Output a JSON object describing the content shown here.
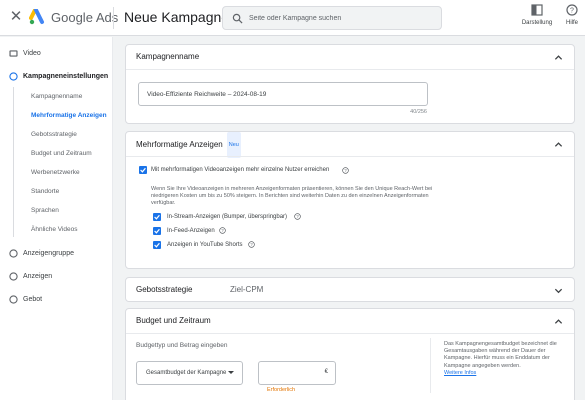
{
  "header": {
    "brand": "Google Ads",
    "title": "Neue Kampagne",
    "search_placeholder": "Seite oder Kampagne suchen",
    "buttons": [
      {
        "label": "Darstellung",
        "icon": "layout-icon"
      },
      {
        "label": "Hilfe",
        "icon": "help-icon"
      }
    ]
  },
  "sidebar": {
    "items": [
      {
        "label": "Video",
        "icon": "video-icon"
      },
      {
        "label": "Kampagneneinstellungen",
        "icon": "circle-outline-icon"
      },
      {
        "label": "Anzeigengruppe",
        "icon": "circle-outline-icon"
      },
      {
        "label": "Anzeigen",
        "icon": "circle-outline-icon"
      },
      {
        "label": "Gebot",
        "icon": "circle-outline-icon"
      }
    ],
    "sub_items": [
      "Kampagnenname",
      "Mehrformatige Anzeigen",
      "Gebotsstrategie",
      "Budget und Zeitraum",
      "Werbenetzwerke",
      "Standorte",
      "Sprachen",
      "Ähnliche Videos"
    ],
    "active_sub_item": "Mehrformatige Anzeigen"
  },
  "campaign_name": {
    "heading": "Kampagnenname",
    "value": "Video-Effiziente Reichweite – 2024-08-19",
    "counter": "40/256"
  },
  "multiformat": {
    "heading": "Mehrformatige Anzeigen",
    "badge": "Neu",
    "main_checkbox_label": "Mit mehrformatigen Videoanzeigen mehr einzelne Nutzer erreichen",
    "description": "Wenn Sie Ihre Videoanzeigen in mehreren Anzeigenformaten präsentieren, können Sie den Unique Reach-Wert bei niedrigeren Kosten um bis zu 50% steigern. In Berichten sind weiterhin Daten zu den einzelnen Anzeigenformaten verfügbar.",
    "options": [
      {
        "label": "In-Stream-Anzeigen (Bumper, überspringbar)",
        "checked": true
      },
      {
        "label": "In-Feed-Anzeigen",
        "checked": true
      },
      {
        "label": "Anzeigen in YouTube Shorts",
        "checked": true
      }
    ]
  },
  "bid_strategy": {
    "heading": "Gebotsstrategie",
    "value": "Ziel-CPM"
  },
  "budget": {
    "heading": "Budget und Zeitraum",
    "label": "Budgettyp und Betrag eingeben",
    "select_value": "Gesamtbudget der Kampagne",
    "currency": "€",
    "required": "Erforderlich",
    "note": "Das Kampagnengesamtbudget bezeichnet die Gesamtausgaben während der Dauer der Kampagne. Hierfür muss ein Enddatum der Kampagne angegeben werden.",
    "link": "Weitere Infos"
  },
  "colors": {
    "accent": "#1a73e8",
    "warning": "#e37400",
    "background": "#f1f3f4"
  }
}
